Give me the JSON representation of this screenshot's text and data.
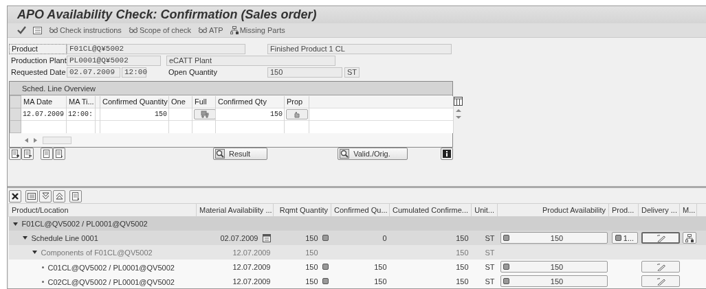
{
  "window": {
    "title": "APO Availability Check: Confirmation (Sales order)"
  },
  "toolbar": {
    "buttons": [
      {
        "label": "Check instructions"
      },
      {
        "label": "Scope of check"
      },
      {
        "label": "ATP"
      },
      {
        "label": "Missing Parts"
      }
    ]
  },
  "header": {
    "product": {
      "label": "Product",
      "value": "F01CL@Q¥5002",
      "description": "Finished Product 1 CL"
    },
    "plant": {
      "label": "Production Plant",
      "value": "PL0001@Q¥5002",
      "description": "eCATT Plant"
    },
    "requested_date": {
      "label": "Requested Date",
      "date": "02.07.2009",
      "time": "12:00"
    },
    "open_quantity": {
      "label": "Open Quantity",
      "value": "150",
      "unit": "ST"
    }
  },
  "schedule_lines": {
    "title": "Sched. Line Overview",
    "columns": [
      "MA Date",
      "MA Ti...",
      "Confirmed Quantity",
      "One",
      "Full",
      "Confirmed Qty",
      "Prop"
    ],
    "rows": [
      {
        "ma_date": "12.07.2009",
        "ma_time": "12:00:",
        "confirmed_quantity": "150",
        "confirmed_qty": "150"
      }
    ]
  },
  "buttons": {
    "result": "Result",
    "valid": "Valid./Orig."
  },
  "tree": {
    "columns": [
      "Product/Location",
      "Material Availability ...",
      "Rqmt Quantity",
      "Confirmed Qu...",
      "Cumulated Confirme...",
      "Unit...",
      "Product Availability",
      "Prod...",
      "Delivery ...",
      "M..."
    ],
    "rows": [
      {
        "kind": "header",
        "label": "F01CL@QV5002 / PL0001@QV5002",
        "expanded": true,
        "children": [
          {
            "kind": "schedule",
            "label": "Schedule Line 0001",
            "expanded": true,
            "date": "02.07.2009",
            "calendar": true,
            "rqmt": "150",
            "rqmt_light": true,
            "confirmed": "0",
            "cumulated": "150",
            "unit": "ST",
            "availability": "150",
            "prod": "1...",
            "delivery_button": true,
            "missing_parts_button": true,
            "children": [
              {
                "kind": "components",
                "label": "Components of F01CL@QV5002",
                "expanded": true,
                "date": "12.07.2009",
                "calendar": false,
                "rqmt": "150",
                "rqmt_light": false,
                "cumulated": "150",
                "unit": "ST",
                "delivery_button": false,
                "missing_parts_button": false,
                "children": [
                  {
                    "kind": "item",
                    "label": "C01CL@QV5002 / PL0001@QV5002",
                    "date": "12.07.2009",
                    "calendar": false,
                    "rqmt": "150",
                    "rqmt_light": true,
                    "confirmed": "150",
                    "cumulated": "150",
                    "unit": "ST",
                    "availability": "150",
                    "delivery_button": true,
                    "missing_parts_button": false
                  },
                  {
                    "kind": "item",
                    "label": "C02CL@QV5002 / PL0001@QV5002",
                    "date": "12.07.2009",
                    "calendar": false,
                    "rqmt": "150",
                    "rqmt_light": true,
                    "confirmed": "150",
                    "cumulated": "150",
                    "unit": "ST",
                    "availability": "150",
                    "delivery_button": true,
                    "missing_parts_button": false
                  }
                ]
              }
            ]
          }
        ]
      }
    ]
  }
}
